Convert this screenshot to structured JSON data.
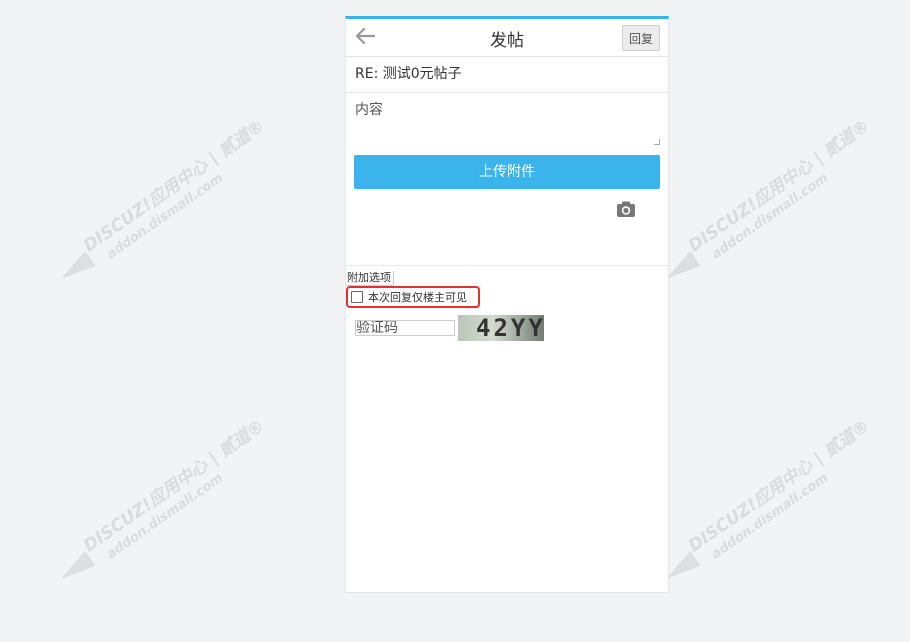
{
  "header": {
    "back_icon": "arrow-left-icon",
    "title": "发帖",
    "reply_label": "回复"
  },
  "form": {
    "subject": "RE: 测试0元帖子",
    "content_placeholder": "内容",
    "upload_label": "上传附件",
    "camera_icon": "camera-icon",
    "options_title": "附加选项",
    "reply_only_op_label": "本次回复仅楼主可见",
    "reply_only_op_checked": false,
    "captcha_placeholder": "验证码",
    "captcha_text": "42YY"
  },
  "watermark": {
    "line1": "DISCUZ!应用中心 | 贰道®",
    "line2": "addon.dismall.com"
  },
  "colors": {
    "accent": "#3bb4ec",
    "highlight": "#e2322e",
    "background": "#f2f3f4"
  }
}
